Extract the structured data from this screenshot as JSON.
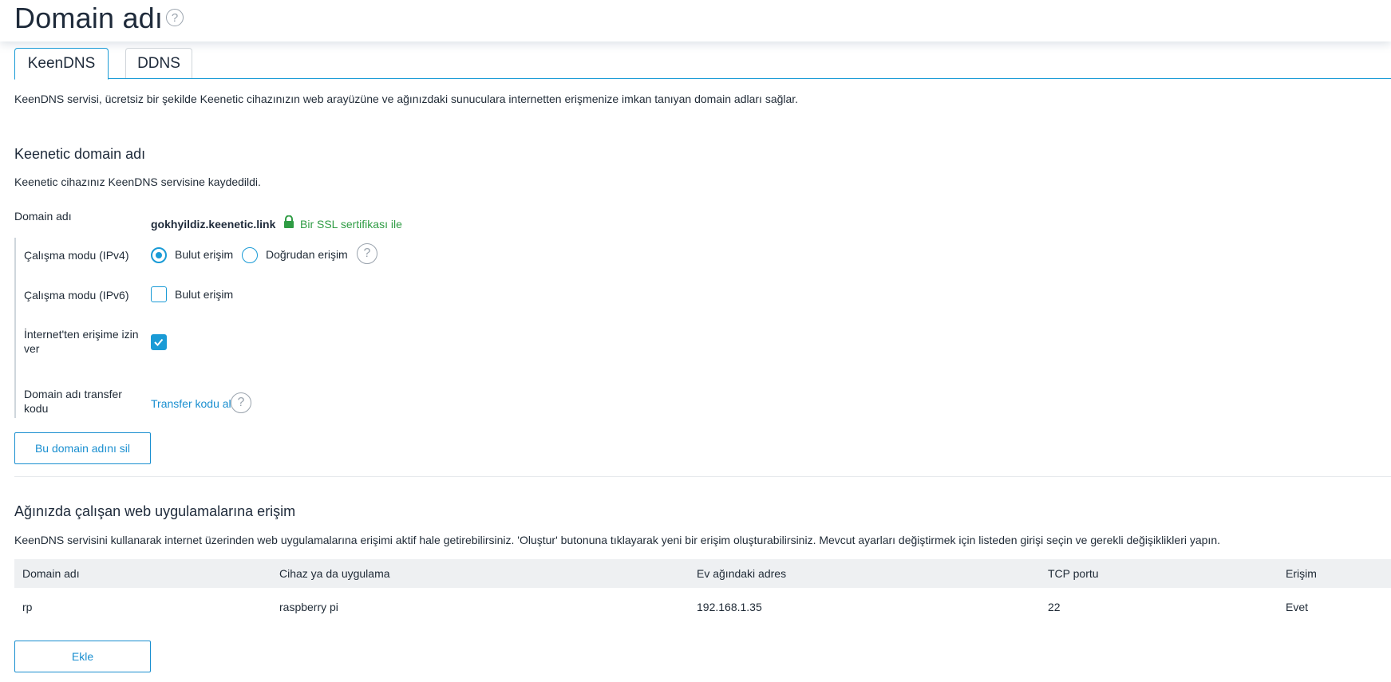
{
  "page": {
    "title": "Domain adı",
    "help": "?"
  },
  "tabs": [
    {
      "label": "KeenDNS",
      "active": true
    },
    {
      "label": "DDNS",
      "active": false
    }
  ],
  "intro": "KeenDNS servisi, ücretsiz bir şekilde Keenetic cihazınızın web arayüzüne ve ağınızdaki sunuculara internetten erişmenize imkan tanıyan domain adları sağlar.",
  "keenetic": {
    "title": "Keenetic domain adı",
    "registered_text": "Keenetic cihazınız KeenDNS servisine kaydedildi.",
    "domain_label": "Domain adı",
    "domain_value": "gokhyildiz.keenetic.link",
    "ssl_text": "Bir SSL sertifikası ile",
    "ipv4": {
      "label": "Çalışma modu (IPv4)",
      "option1": "Bulut erişim",
      "option2": "Doğrudan erişim",
      "selected": "Bulut erişim"
    },
    "ipv6": {
      "label": "Çalışma modu (IPv6)",
      "option": "Bulut erişim",
      "checked": false
    },
    "internet_access": {
      "label_line1": "İnternet'ten erişime izin",
      "label_line2": "ver",
      "checked": true
    },
    "transfer": {
      "label_line1": "Domain adı transfer",
      "label_line2": "kodu",
      "link": "Transfer kodu al"
    },
    "delete_button": "Bu domain adını sil"
  },
  "webapps": {
    "title": "Ağınızda çalışan web uygulamalarına erişim",
    "description": "KeenDNS servisini kullanarak internet üzerinden web uygulamalarına erişimi aktif hale getirebilirsiniz. 'Oluştur' butonuna tıklayarak yeni bir erişim oluşturabilirsiniz. Mevcut ayarları değiştirmek için listeden girişi seçin ve gerekli değişiklikleri yapın.",
    "columns": [
      "Domain adı",
      "Cihaz ya da uygulama",
      "Ev ağındaki adres",
      "TCP portu",
      "Erişim"
    ],
    "rows": [
      [
        "rp",
        "raspberry pi",
        "192.168.1.35",
        "22",
        "Evet"
      ]
    ],
    "add_button": "Ekle"
  },
  "colors": {
    "accent": "#1a9bd6",
    "ssl_green": "#2f9c44",
    "link": "#1a8fd0"
  }
}
